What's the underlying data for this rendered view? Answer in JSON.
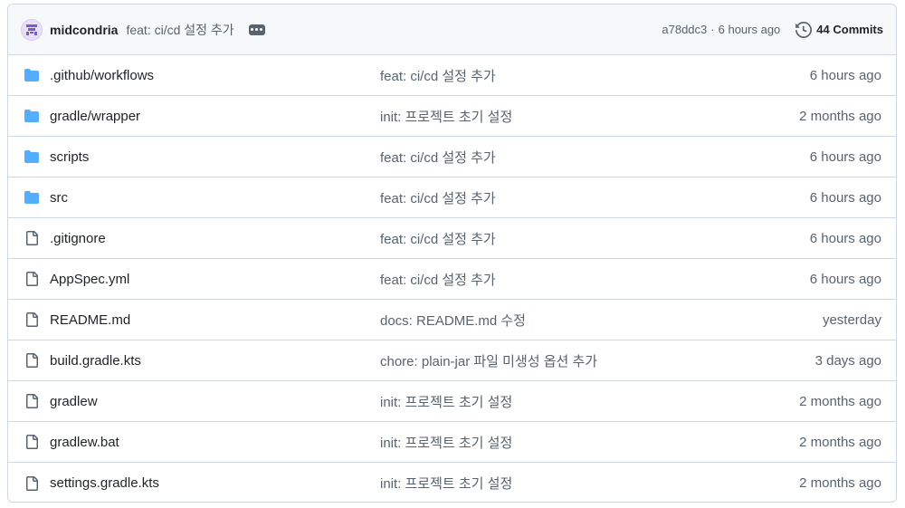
{
  "header": {
    "author": "midcondria",
    "commit_message": "feat: ci/cd 설정 추가",
    "sha": "a78ddc3",
    "separator": "·",
    "time": "6 hours ago",
    "commits_label": "44 Commits"
  },
  "colors": {
    "folder": "#54aeff",
    "file_icon": "#59636e",
    "muted_text": "#59636e",
    "border": "#d0d7de"
  },
  "rows": [
    {
      "type": "folder",
      "name": ".github/workflows",
      "message": "feat: ci/cd 설정 추가",
      "age": "6 hours ago"
    },
    {
      "type": "folder",
      "name": "gradle/wrapper",
      "message": "init: 프로젝트 초기 설정",
      "age": "2 months ago"
    },
    {
      "type": "folder",
      "name": "scripts",
      "message": "feat: ci/cd 설정 추가",
      "age": "6 hours ago"
    },
    {
      "type": "folder",
      "name": "src",
      "message": "feat: ci/cd 설정 추가",
      "age": "6 hours ago"
    },
    {
      "type": "file",
      "name": ".gitignore",
      "message": "feat: ci/cd 설정 추가",
      "age": "6 hours ago"
    },
    {
      "type": "file",
      "name": "AppSpec.yml",
      "message": "feat: ci/cd 설정 추가",
      "age": "6 hours ago"
    },
    {
      "type": "file",
      "name": "README.md",
      "message": "docs: README.md 수정",
      "age": "yesterday"
    },
    {
      "type": "file",
      "name": "build.gradle.kts",
      "message": "chore: plain-jar 파일 미생성 옵션 추가",
      "age": "3 days ago"
    },
    {
      "type": "file",
      "name": "gradlew",
      "message": "init: 프로젝트 초기 설정",
      "age": "2 months ago"
    },
    {
      "type": "file",
      "name": "gradlew.bat",
      "message": "init: 프로젝트 초기 설정",
      "age": "2 months ago"
    },
    {
      "type": "file",
      "name": "settings.gradle.kts",
      "message": "init: 프로젝트 초기 설정",
      "age": "2 months ago"
    }
  ]
}
